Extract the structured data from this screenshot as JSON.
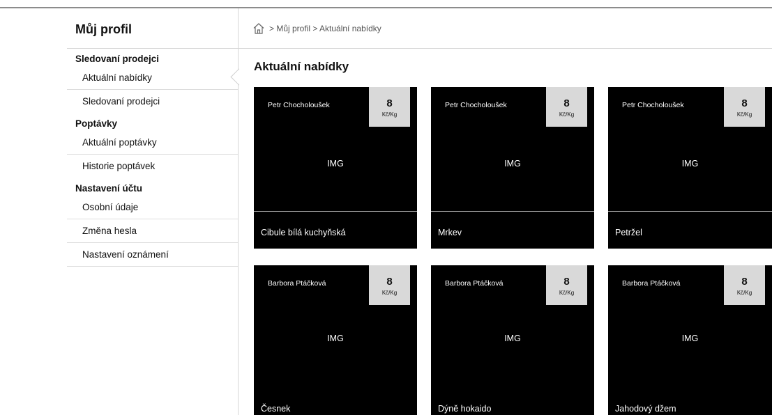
{
  "sidebar": {
    "title": "Můj profil",
    "groups": [
      {
        "heading": "Sledovaní prodejci",
        "items": [
          {
            "label": "Aktuální nabídky"
          },
          {
            "label": "Sledovaní prodejci"
          }
        ]
      },
      {
        "heading": "Poptávky",
        "items": [
          {
            "label": "Aktuální poptávky"
          },
          {
            "label": "Historie poptávek"
          }
        ]
      },
      {
        "heading": "Nastavení účtu",
        "items": [
          {
            "label": "Osobní údaje"
          },
          {
            "label": "Změna hesla"
          },
          {
            "label": "Nastavení oznámení"
          }
        ]
      }
    ]
  },
  "breadcrumb": {
    "icon": "home-icon",
    "text": "> Můj profil > Aktuální nabídky"
  },
  "page_title": "Aktuální nabídky",
  "cards": [
    {
      "seller": "Petr Chocholoušek",
      "price": "8",
      "unit": "Kč/Kg",
      "image_label": "IMG",
      "product": "Cibule bílá kuchyňská"
    },
    {
      "seller": "Petr Chocholoušek",
      "price": "8",
      "unit": "Kč/Kg",
      "image_label": "IMG",
      "product": "Mrkev"
    },
    {
      "seller": "Petr Chocholoušek",
      "price": "8",
      "unit": "Kč/Kg",
      "image_label": "IMG",
      "product": "Petržel"
    },
    {
      "seller": "Barbora Ptáčková",
      "price": "8",
      "unit": "Kč/Kg",
      "image_label": "IMG",
      "product": "Česnek"
    },
    {
      "seller": "Barbora Ptáčková",
      "price": "8",
      "unit": "Kč/Kg",
      "image_label": "IMG",
      "product": "Dýně hokaido"
    },
    {
      "seller": "Barbora Ptáčková",
      "price": "8",
      "unit": "Kč/Kg",
      "image_label": "IMG",
      "product": "Jahodový džem"
    }
  ]
}
